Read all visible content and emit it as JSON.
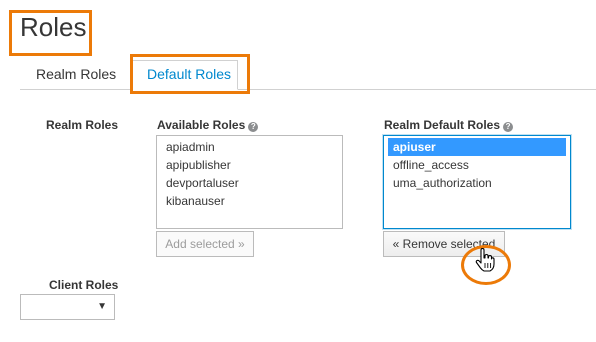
{
  "page": {
    "title": "Roles"
  },
  "tabs": [
    {
      "label": "Realm Roles",
      "active": false
    },
    {
      "label": "Default Roles",
      "active": true
    }
  ],
  "realm_roles": {
    "section_label": "Realm Roles",
    "available": {
      "label": "Available Roles",
      "items": [
        "apiadmin",
        "apipublisher",
        "devportaluser",
        "kibanauser"
      ],
      "button": "Add selected »"
    },
    "default": {
      "label": "Realm Default Roles",
      "items": [
        "apiuser",
        "offline_access",
        "uma_authorization"
      ],
      "selected_index": 0,
      "button": "« Remove selected"
    }
  },
  "client_roles": {
    "label": "Client Roles",
    "selected": ""
  },
  "colors": {
    "highlight": "#ec7a08",
    "link": "#0088ce",
    "selection": "#3399ff"
  },
  "icons": {
    "help": "question-circle-icon",
    "cursor": "hand-pointer-icon",
    "dropdown": "caret-down-icon"
  }
}
